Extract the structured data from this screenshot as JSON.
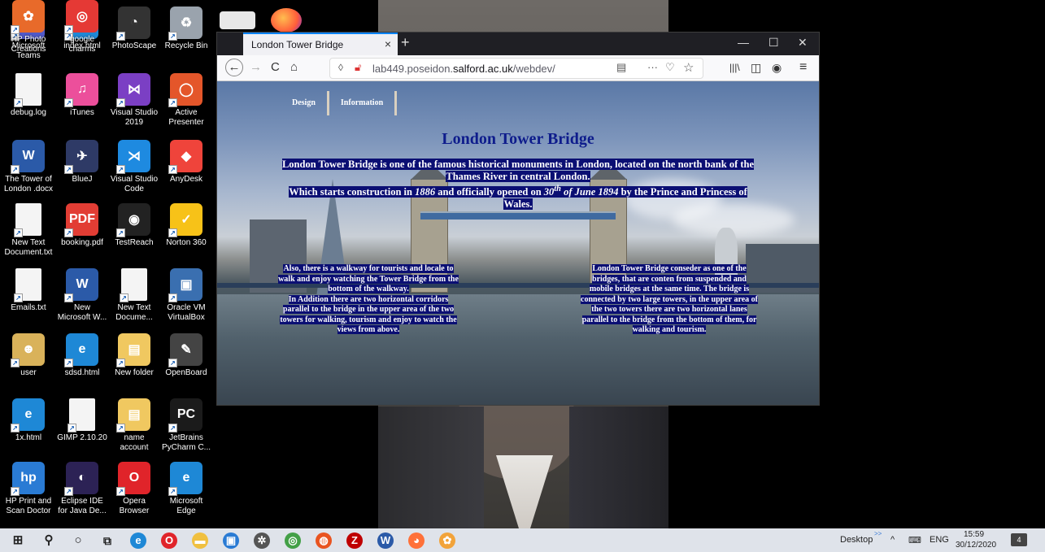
{
  "desktop": {
    "icons": [
      {
        "label": "Microsoft Teams",
        "glyph": "T",
        "color": "#5059c9"
      },
      {
        "label": "index.html",
        "glyph": "e",
        "color": "#1e88d6"
      },
      {
        "label": "PhotoScape",
        "glyph": "◔",
        "color": "#333333"
      },
      {
        "label": "Recycle Bin",
        "glyph": "♻",
        "color": "#9aa3ad"
      },
      {
        "label": "debug.log",
        "glyph": "",
        "color": "#f4f4f4"
      },
      {
        "label": "iTunes",
        "glyph": "♫",
        "color": "#ec4f9b"
      },
      {
        "label": "Visual Studio 2019",
        "glyph": "⋈",
        "color": "#7b3fc4"
      },
      {
        "label": "Active Presenter",
        "glyph": "◯",
        "color": "#e4562a"
      },
      {
        "label": "The Tower of London .docx",
        "glyph": "W",
        "color": "#2b5aa8"
      },
      {
        "label": "BlueJ",
        "glyph": "✈",
        "color": "#2e3a66"
      },
      {
        "label": "Visual Studio Code",
        "glyph": "⋊",
        "color": "#1e8ae0"
      },
      {
        "label": "AnyDesk",
        "glyph": "◆",
        "color": "#ef443b"
      },
      {
        "label": "New Text Document.txt",
        "glyph": "",
        "color": "#f4f4f4"
      },
      {
        "label": "booking.pdf",
        "glyph": "PDF",
        "color": "#e23d34"
      },
      {
        "label": "TestReach",
        "glyph": "◉",
        "color": "#222222"
      },
      {
        "label": "Norton 360",
        "glyph": "✓",
        "color": "#f7c218"
      },
      {
        "label": "Emails.txt",
        "glyph": "",
        "color": "#f4f4f4"
      },
      {
        "label": "New Microsoft W...",
        "glyph": "W",
        "color": "#2b5aa8"
      },
      {
        "label": "New Text Docume...",
        "glyph": "",
        "color": "#f4f4f4"
      },
      {
        "label": "Oracle VM VirtualBox",
        "glyph": "▣",
        "color": "#3a6fb0"
      },
      {
        "label": "user",
        "glyph": "☻",
        "color": "#d9b25a"
      },
      {
        "label": "sdsd.html",
        "glyph": "e",
        "color": "#1e88d6"
      },
      {
        "label": "New folder",
        "glyph": "▤",
        "color": "#f0c860"
      },
      {
        "label": "OpenBoard",
        "glyph": "✎",
        "color": "#444444"
      },
      {
        "label": "1x.html",
        "glyph": "e",
        "color": "#1e88d6"
      },
      {
        "label": "GIMP 2.10.20",
        "glyph": "",
        "color": "#f4f4f4"
      },
      {
        "label": "name account",
        "glyph": "▤",
        "color": "#f0c860"
      },
      {
        "label": "JetBrains PyCharm C...",
        "glyph": "PC",
        "color": "#1b1b1b"
      },
      {
        "label": "HP Print and Scan Doctor",
        "glyph": "hp",
        "color": "#2a7bd4"
      },
      {
        "label": "Eclipse IDE for Java De...",
        "glyph": "◐",
        "color": "#2c2255"
      },
      {
        "label": "Opera Browser",
        "glyph": "O",
        "color": "#e0242a"
      },
      {
        "label": "Microsoft Edge",
        "glyph": "e",
        "color": "#1e88d6"
      },
      {
        "label": "HP Photo Creations",
        "glyph": "✿",
        "color": "#e86a2a"
      },
      {
        "label": "google charms",
        "glyph": "◎",
        "color": "#e53935"
      }
    ]
  },
  "browser": {
    "tab_title": "London Tower Bridge",
    "tab_close": "×",
    "new_tab": "+",
    "win_min": "—",
    "win_max": "☐",
    "win_close": "✕",
    "back": "←",
    "forward": "→",
    "reload": "C",
    "home": "⌂",
    "url_prefix": "lab449.poseidon.",
    "url_domain": "salford.ac.uk",
    "url_path": "/webdev/",
    "reader": "▤",
    "more": "···",
    "pocket": "♡",
    "star": "☆",
    "library": "|||\\",
    "sidebar": "◫",
    "account": "◉",
    "menu": "≡"
  },
  "page": {
    "nav": [
      "Design",
      "Information"
    ],
    "title": "London Tower Bridge",
    "intro_line1": "London Tower Bridge is one of the famous historical monuments in London, located on the north bank of the Thames River in central London.",
    "intro_line2a": "Which starts construction in ",
    "intro_year": "1886",
    "intro_line2b": " and officially opened on ",
    "intro_date_num": "30",
    "intro_date_sup": "th",
    "intro_date_rest": " of June 1894",
    "intro_line2c": " by the Prince and Princess of Wales.",
    "left_para1": "Also, there is a walkway for tourists and locale to walk and enjoy watching the Tower Bridge from the bottom of the walkway.",
    "left_para2": "In Addition there are two horizontal corridors parallel to the bridge in the upper area of the two towers for walking, tourism and enjoy to watch the views from above.",
    "right_para": "London Tower Bridge conseder as one of the bridges, that are conten from suspended and mobile bridges at the same time. The bridge is connected by two large towers, in the upper area of the two towers there are two horizontal lanes parallel to the bridge from the bottom of them, for walking and tourism."
  },
  "taskbar": {
    "start": "⊞",
    "search": "⚲",
    "cortana": "○",
    "taskview": "⧉",
    "apps": [
      {
        "name": "edge-icon",
        "glyph": "e",
        "color": "#1e88d6"
      },
      {
        "name": "opera-icon",
        "glyph": "O",
        "color": "#e0242a"
      },
      {
        "name": "file-explorer-icon",
        "glyph": "▬",
        "color": "#f0c040"
      },
      {
        "name": "photos-icon",
        "glyph": "▣",
        "color": "#2a7bd4"
      },
      {
        "name": "settings-icon",
        "glyph": "✲",
        "color": "#555555"
      },
      {
        "name": "chrome-icon",
        "glyph": "◎",
        "color": "#43a047"
      },
      {
        "name": "ubuntu-icon",
        "glyph": "◍",
        "color": "#e95420"
      },
      {
        "name": "filezilla-icon",
        "glyph": "Z",
        "color": "#bf0000"
      },
      {
        "name": "word-icon",
        "glyph": "W",
        "color": "#2b5aa8"
      },
      {
        "name": "firefox-icon",
        "glyph": "◕",
        "color": "#ff7139"
      },
      {
        "name": "paint-icon",
        "glyph": "✿",
        "color": "#f2a33a"
      }
    ],
    "desktop_label": "Desktop",
    "chevron": ">>",
    "up_arrow": "^",
    "keyboard": "⌨",
    "lang": "ENG",
    "time": "15:59",
    "date": "30/12/2020",
    "notif_count": "4"
  }
}
